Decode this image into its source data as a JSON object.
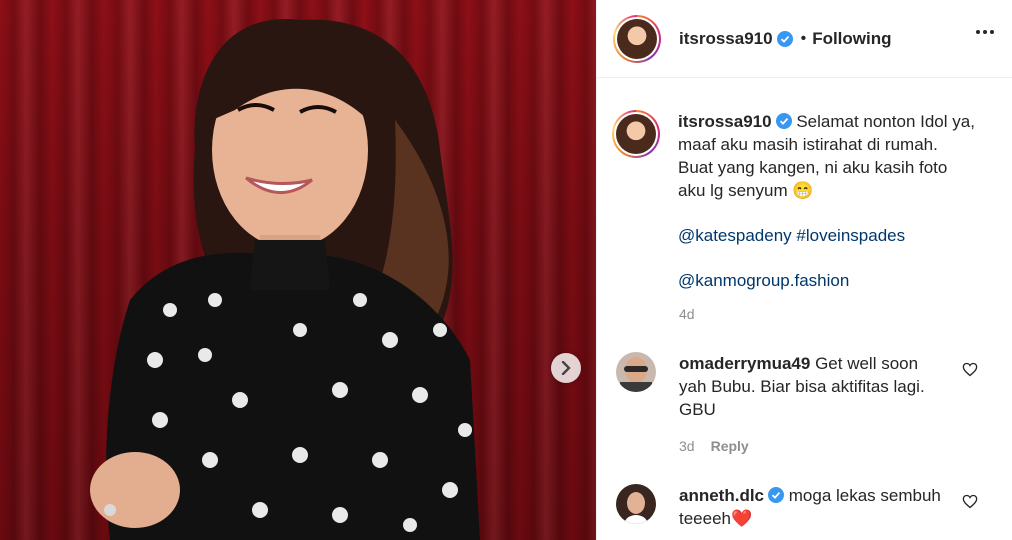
{
  "post": {
    "username": "itsrossa910",
    "follow_state": "Following",
    "separator": "•",
    "caption_lines": [
      "Selamat nonton Idol ya,",
      "maaf aku masih istirahat di rumah.",
      "Buat yang kangen, ni aku kasih foto",
      "aku lg senyum 😁"
    ],
    "tags_line1": [
      "@katespadeny",
      "#loveinspades"
    ],
    "tags_line2": [
      "@kanmogroup.fashion"
    ],
    "time": "4d"
  },
  "comments": [
    {
      "username": "omaderrymua49",
      "text_lines": [
        "Get well soon",
        "yah Bubu. Biar bisa aktifitas lagi.",
        "GBU"
      ],
      "time": "3d",
      "reply_label": "Reply"
    },
    {
      "username": "anneth.dlc",
      "text_lines": [
        "moga lekas sembuh",
        "teeeeh❤️"
      ]
    }
  ],
  "icons": {
    "verified": "verified-badge-icon",
    "more": "more-options-icon",
    "next": "chevron-right-icon",
    "heart": "heart-outline-icon"
  },
  "colors": {
    "verified_blue": "#3897f0",
    "link": "#00376b",
    "secondary_text": "#8e8e8e",
    "curtain_red": "#7a0c13"
  }
}
